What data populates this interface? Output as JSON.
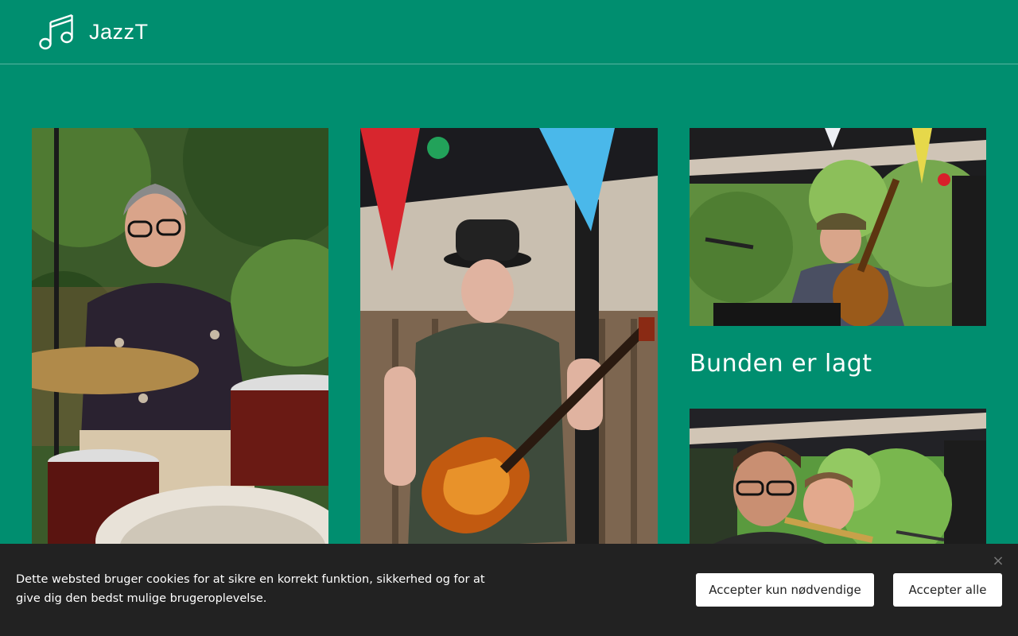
{
  "header": {
    "logo_icon": "music-note-icon",
    "site_title": "JazzT"
  },
  "gallery": {
    "photos": [
      {
        "alt": "drummer-photo"
      },
      {
        "alt": "guitarist-photo"
      },
      {
        "alt": "bassist-photo"
      },
      {
        "alt": "saxophonist-photo"
      }
    ],
    "post_title": "Bunden er lagt"
  },
  "cookie_banner": {
    "message": "Dette websted bruger cookies for at sikre en korrekt funktion, sikkerhed og for at give dig den bedst mulige brugeroplevelse.",
    "accept_necessary_label": "Accepter kun nødvendige",
    "accept_all_label": "Accepter alle",
    "close_icon": "close-icon",
    "close_glyph": "×"
  },
  "colors": {
    "brand": "#008e6f",
    "cookie_bg": "#222222",
    "button_bg": "#ffffff"
  }
}
